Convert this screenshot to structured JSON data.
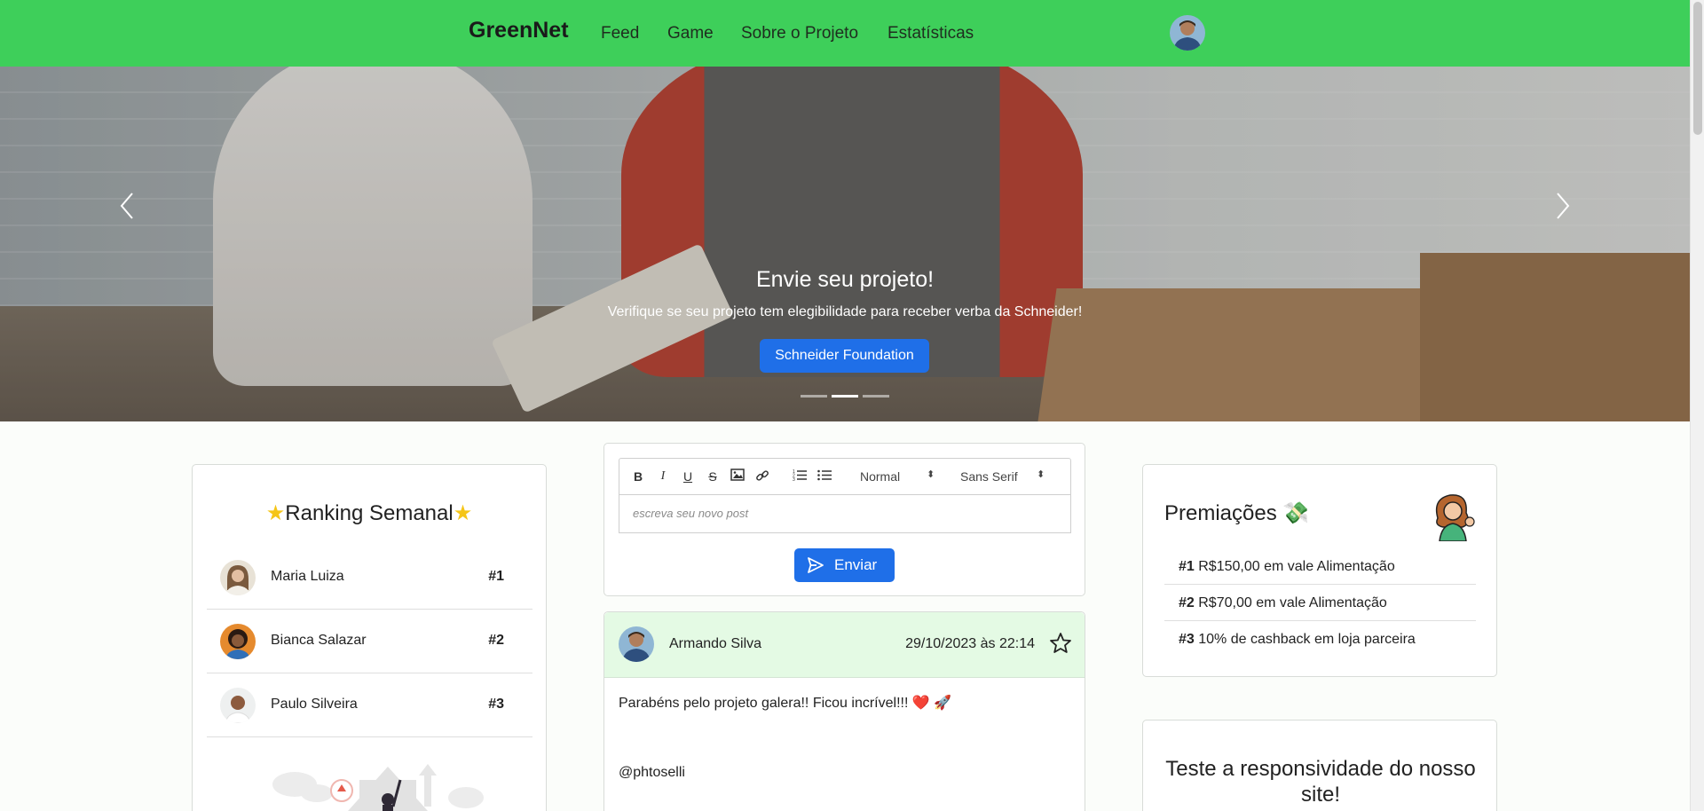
{
  "nav": {
    "brand": "GreenNet",
    "links": [
      "Feed",
      "Game",
      "Sobre o Projeto",
      "Estatísticas"
    ]
  },
  "hero": {
    "title": "Envie seu projeto!",
    "subtitle": "Verifique se seu projeto tem elegibilidade para receber verba da Schneider!",
    "button": "Schneider Foundation",
    "prev_icon": "chevron-left-icon",
    "next_icon": "chevron-right-icon",
    "slide_count": 3,
    "active_slide": 2
  },
  "ranking": {
    "title": "Ranking Semanal",
    "entries": [
      {
        "name": "Maria Luiza",
        "position": "#1"
      },
      {
        "name": "Bianca Salazar",
        "position": "#2"
      },
      {
        "name": "Paulo Silveira",
        "position": "#3"
      }
    ]
  },
  "editor": {
    "toolbar": {
      "bold": "B",
      "italic": "I",
      "underline": "U",
      "strike": "S",
      "size": "Normal",
      "font": "Sans Serif"
    },
    "placeholder": "escreva seu novo post",
    "send": "Enviar"
  },
  "post": {
    "author": "Armando Silva",
    "date": "29/10/2023 às 22:14",
    "text": "Parabéns pelo projeto galera!! Ficou incrível!!! ❤️ 🚀",
    "mention": "@phtoselli"
  },
  "prizes": {
    "title": "Premiações 💸",
    "items": [
      {
        "rank": "#1",
        "text": "R$150,00 em vale Alimentação"
      },
      {
        "rank": "#2",
        "text": "R$70,00 em vale Alimentação"
      },
      {
        "rank": "#3",
        "text": "10% de cashback em loja parceira"
      }
    ]
  },
  "responsive": {
    "title": "Teste a responsividade do nosso site!"
  },
  "colors": {
    "nav_green": "#3ecf5a",
    "primary_blue": "#1f6fe8",
    "post_header": "#e4fae4",
    "star": "#f5c518"
  }
}
